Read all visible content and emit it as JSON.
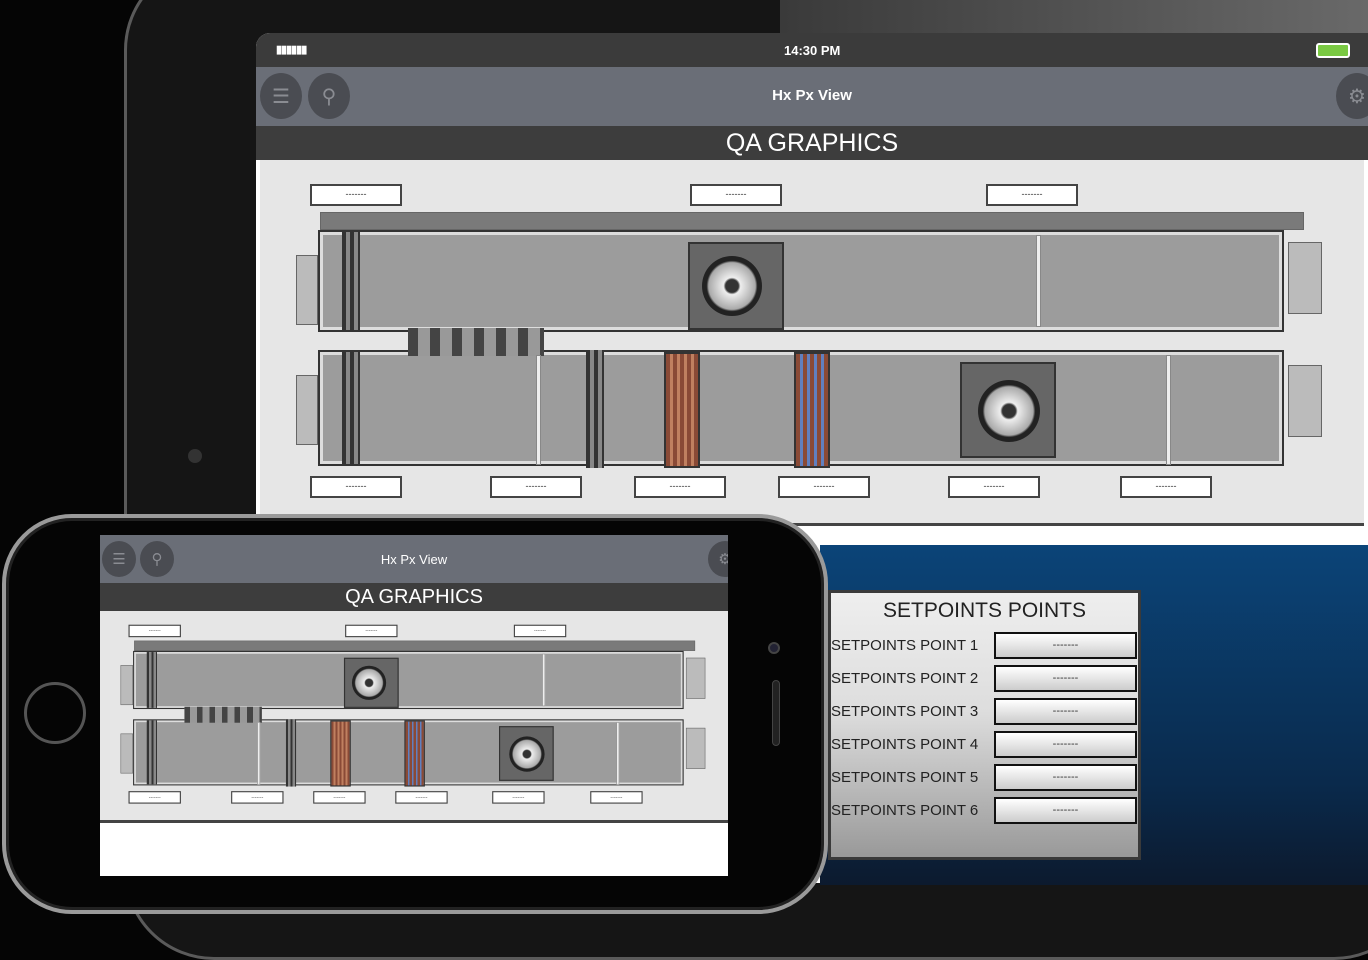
{
  "tablet": {
    "status": {
      "signal": "▮▮▮▮▮▮",
      "time": "14:30 PM"
    },
    "appbar": {
      "title": "Hx Px View"
    },
    "page_title": "QA GRAPHICS"
  },
  "phone": {
    "appbar": {
      "title": "Hx Px View"
    },
    "page_title": "QA GRAPHICS"
  },
  "diagram": {
    "top_values": [
      "-------",
      "-------",
      "-------"
    ],
    "bottom_values": [
      "-------",
      "-------",
      "-------",
      "-------",
      "-------",
      "-------"
    ]
  },
  "setpoints": {
    "title": "SETPOINTS POINTS",
    "rows": [
      {
        "label": "SETPOINTS POINT 1",
        "value": "-------"
      },
      {
        "label": "SETPOINTS POINT 2",
        "value": "-------"
      },
      {
        "label": "SETPOINTS POINT 3",
        "value": "-------"
      },
      {
        "label": "SETPOINTS POINT 4",
        "value": "-------"
      },
      {
        "label": "SETPOINTS POINT 5",
        "value": "-------"
      },
      {
        "label": "SETPOINTS POINT 6",
        "value": "-------"
      }
    ]
  },
  "colors": {
    "appbar": "#6a6e77",
    "titlebar": "#3d3d3d",
    "battery": "#7ac943",
    "panel_bg": "#0b4478"
  }
}
